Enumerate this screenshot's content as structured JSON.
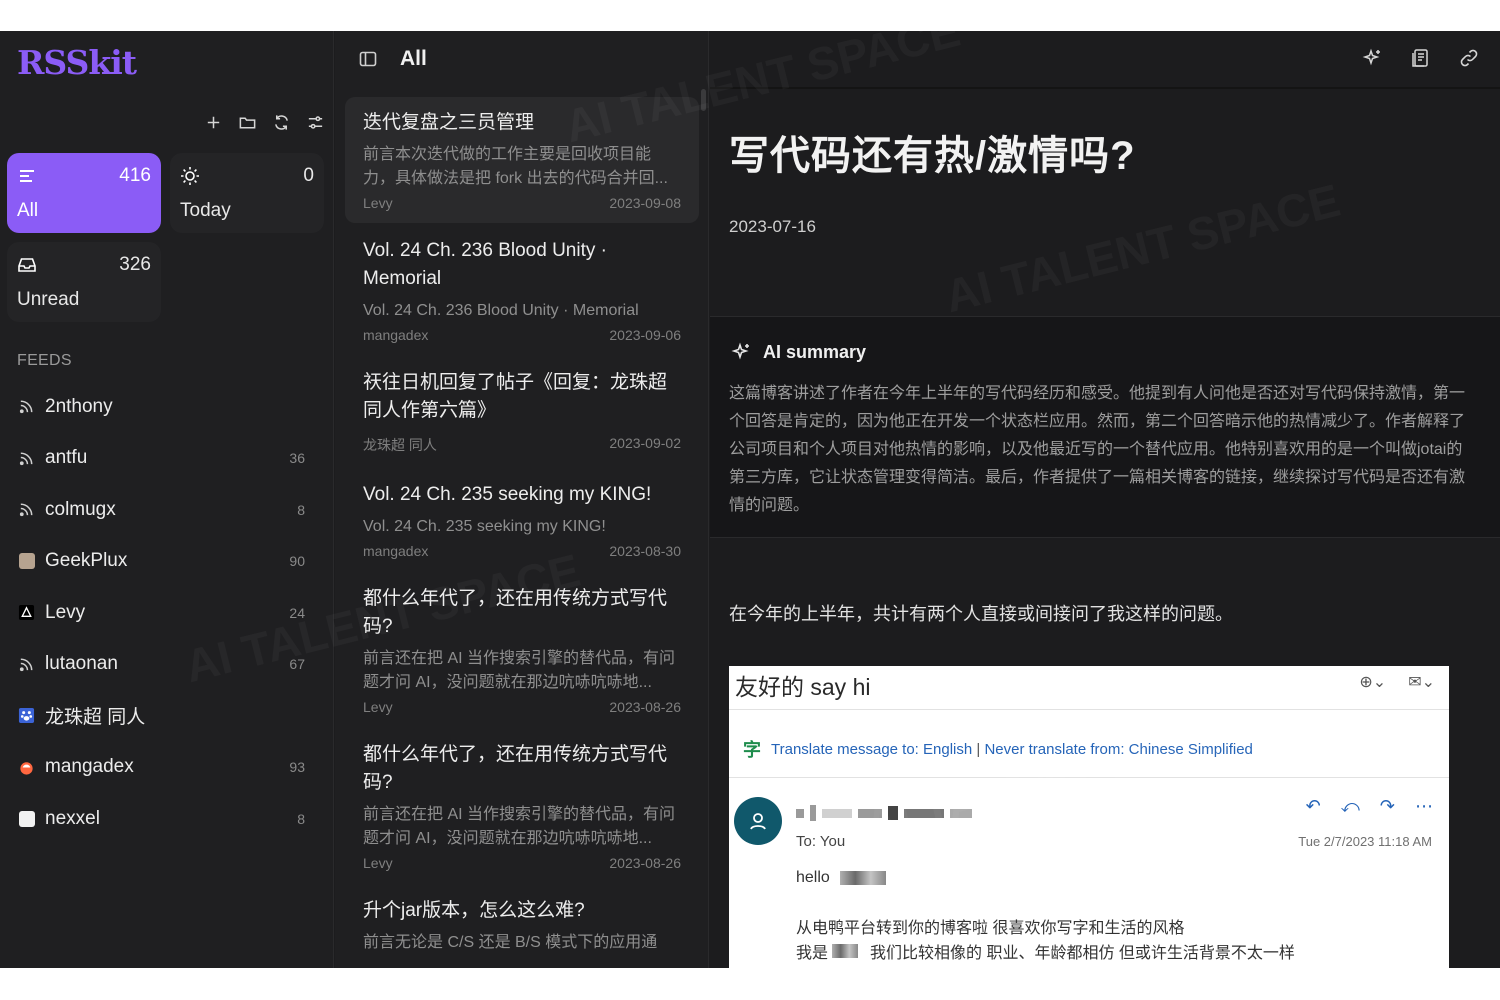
{
  "app": {
    "name": "RSSkit"
  },
  "sidebar": {
    "toolbar": [
      "add-icon",
      "folder-icon",
      "refresh-icon",
      "filter-icon"
    ],
    "cards": {
      "all": {
        "label": "All",
        "count": "416"
      },
      "today": {
        "label": "Today",
        "count": "0"
      },
      "unread": {
        "label": "Unread",
        "count": "326"
      }
    },
    "feeds_heading": "FEEDS",
    "feeds": [
      {
        "name": "2nthony",
        "count": "",
        "icon": "rss-icon"
      },
      {
        "name": "antfu",
        "count": "36",
        "icon": "rss-icon"
      },
      {
        "name": "colmugx",
        "count": "8",
        "icon": "rss-icon"
      },
      {
        "name": "GeekPlux",
        "count": "90",
        "icon": "favicon",
        "color": "#b6a390"
      },
      {
        "name": "Levy",
        "count": "24",
        "icon": "favicon",
        "color": "#ffffff"
      },
      {
        "name": "lutaonan",
        "count": "67",
        "icon": "rss-icon"
      },
      {
        "name": "龙珠超 同人",
        "count": "",
        "icon": "favicon",
        "color": "#3b63d6"
      },
      {
        "name": "mangadex",
        "count": "93",
        "icon": "favicon",
        "color": "#ff6740"
      },
      {
        "name": "nexxel",
        "count": "8",
        "icon": "favicon",
        "color": "#f2f2f2"
      }
    ]
  },
  "list": {
    "title": "All",
    "articles": [
      {
        "title": "迭代复盘之三员管理",
        "desc": "前言本次迭代做的工作主要是回收项目能力，具体做法是把 fork 出去的代码合并回...",
        "source": "Levy",
        "date": "2023-09-08",
        "selected": true
      },
      {
        "title": "Vol. 24 Ch. 236 Blood Unity · Memorial",
        "desc": "Vol. 24 Ch. 236 Blood Unity · Memorial",
        "source": "mangadex",
        "date": "2023-09-06"
      },
      {
        "title": "祆往日机回复了帖子《回复：龙珠超同人作第六篇》",
        "desc": "",
        "source": "龙珠超 同人",
        "date": "2023-09-02"
      },
      {
        "title": "Vol. 24 Ch. 235 seeking my KING!",
        "desc": "Vol. 24 Ch. 235 seeking my KING!",
        "source": "mangadex",
        "date": "2023-08-30"
      },
      {
        "title": "都什么年代了，还在用传统方式写代码?",
        "desc": "前言还在把 AI 当作搜索引擎的替代品，有问题才问 AI，没问题就在那边吭哧吭哧地...",
        "source": "Levy",
        "date": "2023-08-26"
      },
      {
        "title": "都什么年代了，还在用传统方式写代码?",
        "desc": "前言还在把 AI 当作搜索引擎的替代品，有问题才问 AI，没问题就在那边吭哧吭哧地...",
        "source": "Levy",
        "date": "2023-08-26"
      },
      {
        "title": "升个jar版本，怎么这么难?",
        "desc": "前言无论是 C/S 还是 B/S 模式下的应用通",
        "source": "",
        "date": ""
      }
    ]
  },
  "article": {
    "title": "写代码还有热/激情吗?",
    "date": "2023-07-16",
    "ai_summary_label": "AI summary",
    "ai_summary": "这篇博客讲述了作者在今年上半年的写代码经历和感受。他提到有人问他是否还对写代码保持激情，第一个回答是肯定的，因为他正在开发一个状态栏应用。然而，第二个回答暗示他的热情减少了。作者解释了公司项目和个人项目对他热情的影响，以及他最近写的一个替代应用。他特别喜欢用的是一个叫做jotai的第三方库，它让状态管理变得简洁。最后，作者提供了一篇相关博客的链接，继续探讨写代码是否还有激情的问题。",
    "paragraph": "在今年的上半年，共计有两个人直接或间接问了我这样的问题。",
    "email": {
      "subject": "友好的 say hi",
      "translate_prefix": "Translate message to: English",
      "translate_sep": " | ",
      "translate_suffix": "Never translate from: Chinese Simplified",
      "to": "To:  You",
      "date": "Tue 2/7/2023 11:18 AM",
      "hello": "hello",
      "line1": "从电鸭平台转到你的博客啦 很喜欢你写字和生活的风格",
      "line2_a": "我是",
      "line2_b": "我们比较相像的 职业、年龄都相仿 但或许生活背景不太一样"
    }
  },
  "colors": {
    "accent": "#8b5cf6",
    "background": "#1c1c1e",
    "link": "#2564b8"
  },
  "watermark": "AI TALENT SPACE"
}
